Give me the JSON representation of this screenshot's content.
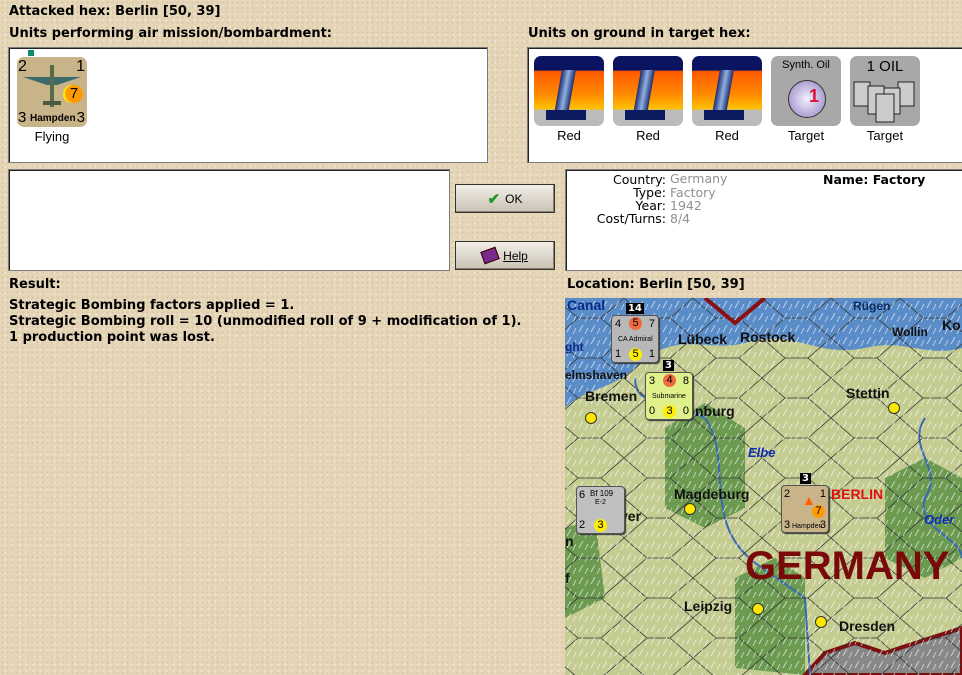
{
  "header": {
    "title": "Attacked hex: Berlin  [50, 39]"
  },
  "air_units": {
    "label": "Units performing air mission/bombardment:",
    "units": [
      {
        "name": "Hampden",
        "top_left": "2",
        "top_right": "1",
        "bottom_left": "3",
        "bottom_right": "3",
        "badge": "7",
        "status": "Flying"
      }
    ]
  },
  "ground_units": {
    "label": "Units on ground in target hex:",
    "units": [
      {
        "caption": "Red",
        "icon": "factory-icon"
      },
      {
        "caption": "Red",
        "icon": "factory-icon"
      },
      {
        "caption": "Red",
        "icon": "factory-icon"
      },
      {
        "caption": "Target",
        "icon": "synthetic-oil-icon",
        "title": "Synth. Oil",
        "value": "1"
      },
      {
        "caption": "Target",
        "icon": "oil-barrels-icon",
        "title": "1 OIL"
      }
    ]
  },
  "buttons": {
    "ok": "OK",
    "help": "Help"
  },
  "info": {
    "country_label": "Country:",
    "country": "Germany",
    "type_label": "Type:",
    "type": "Factory",
    "year_label": "Year:",
    "year": "1942",
    "cost_label": "Cost/Turns:",
    "cost": "8/4",
    "name": "Name: Factory"
  },
  "result": {
    "label": "Result:",
    "lines": [
      "Strategic Bombing factors applied = 1.",
      "Strategic Bombing roll = 10 (unmodified roll of 9 + modification of 1).",
      "1 production point was lost."
    ]
  },
  "location": {
    "label": "Location:  Berlin  [50, 39]"
  },
  "map": {
    "labels": {
      "canal": "Canal",
      "rugen": "Rügen",
      "wollin": "Wollin",
      "ko": "Ko",
      "lubeck": "Lübeck",
      "rostock": "Rostock",
      "ght": "ght",
      "elmshaven": "elmshaven",
      "bremen": "Bremen",
      "nburg": "nburg",
      "stettin": "Stettin",
      "elbe": "Elbe",
      "magdeburg": "Magdeburg",
      "berlin": "BERLIN",
      "oder": "Oder",
      "ver": "ver",
      "germany": "GERMANY",
      "leipzig": "Leipzig",
      "dresden": "Dresden",
      "f": "f",
      "n": "n"
    },
    "counters": {
      "naval": {
        "stack": "14",
        "tl": "4",
        "tc": "5",
        "tr": "7",
        "name": "CA Admiral",
        "bl": "1",
        "bc": "5",
        "br": "1"
      },
      "sub": {
        "stack": "3",
        "tl": "3",
        "tc": "4",
        "tr": "8",
        "name": "Submarine",
        "bl": "0",
        "bc": "3",
        "br": "0"
      },
      "fighter": {
        "tl": "6",
        "name": "Bf 109",
        "sub": "E-2",
        "bl": "2",
        "bc": "3"
      },
      "bomber": {
        "stack": "3",
        "tl": "2",
        "tr": "1",
        "badge": "7",
        "bl": "3",
        "name": "Hampden",
        "br": "3"
      }
    }
  }
}
